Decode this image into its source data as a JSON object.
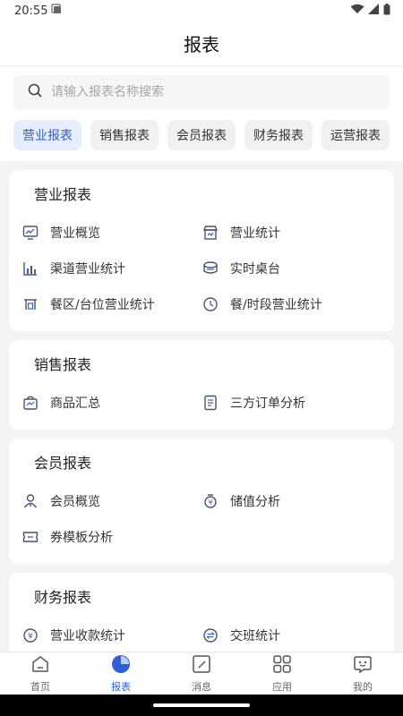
{
  "status": {
    "time": "20:55"
  },
  "header": {
    "title": "报表"
  },
  "search": {
    "placeholder": "请输入报表名称搜索"
  },
  "chips": [
    "营业报表",
    "销售报表",
    "会员报表",
    "财务报表",
    "运营报表"
  ],
  "sections": [
    {
      "title": "营业报表",
      "items": [
        {
          "label": "营业概览",
          "icon": "chart-monitor-icon"
        },
        {
          "label": "营业统计",
          "icon": "store-icon"
        },
        {
          "label": "渠道营业统计",
          "icon": "bar-chart-icon"
        },
        {
          "label": "实时桌台",
          "icon": "table-icon"
        },
        {
          "label": "餐区/台位营业统计",
          "icon": "dining-area-icon"
        },
        {
          "label": "餐/时段营业统计",
          "icon": "clock-chart-icon"
        }
      ]
    },
    {
      "title": "销售报表",
      "items": [
        {
          "label": "商品汇总",
          "icon": "shopping-bag-icon"
        },
        {
          "label": "三方订单分析",
          "icon": "order-list-icon"
        }
      ]
    },
    {
      "title": "会员报表",
      "items": [
        {
          "label": "会员概览",
          "icon": "member-icon"
        },
        {
          "label": "储值分析",
          "icon": "stored-value-icon"
        },
        {
          "label": "券模板分析",
          "icon": "coupon-icon"
        }
      ]
    },
    {
      "title": "财务报表",
      "items": [
        {
          "label": "营业收款统计",
          "icon": "yuan-coin-icon"
        },
        {
          "label": "交班统计",
          "icon": "shift-exchange-icon"
        }
      ]
    }
  ],
  "tabbar": [
    {
      "label": "首页",
      "icon": "home-icon"
    },
    {
      "label": "报表",
      "icon": "pie-chart-icon"
    },
    {
      "label": "消息",
      "icon": "message-icon"
    },
    {
      "label": "应用",
      "icon": "apps-grid-icon"
    },
    {
      "label": "我的",
      "icon": "profile-icon"
    }
  ],
  "colors": {
    "accent": "#2f5fd0",
    "chip_active_bg": "#e6edfb",
    "icon_dark": "#4a5468"
  }
}
